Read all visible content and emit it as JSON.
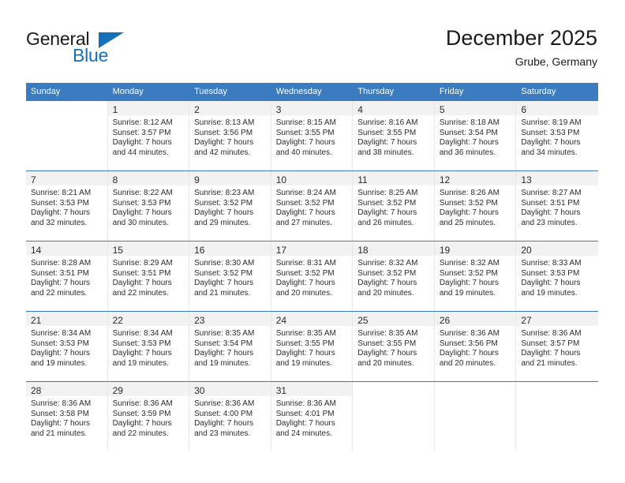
{
  "brand": {
    "name_part1": "General",
    "name_part2": "Blue",
    "flag_icon": "blue-triangle-flag-icon",
    "accent_color": "#1470b8"
  },
  "header": {
    "month_title": "December 2025",
    "location": "Grube, Germany"
  },
  "calendar": {
    "header_bg": "#3a7cbf",
    "daynum_bg": "#f2f2f2",
    "weekday_headers": [
      "Sunday",
      "Monday",
      "Tuesday",
      "Wednesday",
      "Thursday",
      "Friday",
      "Saturday"
    ],
    "weeks": [
      [
        {
          "day": "",
          "lines": []
        },
        {
          "day": "1",
          "lines": [
            "Sunrise: 8:12 AM",
            "Sunset: 3:57 PM",
            "Daylight: 7 hours",
            "and 44 minutes."
          ]
        },
        {
          "day": "2",
          "lines": [
            "Sunrise: 8:13 AM",
            "Sunset: 3:56 PM",
            "Daylight: 7 hours",
            "and 42 minutes."
          ]
        },
        {
          "day": "3",
          "lines": [
            "Sunrise: 8:15 AM",
            "Sunset: 3:55 PM",
            "Daylight: 7 hours",
            "and 40 minutes."
          ]
        },
        {
          "day": "4",
          "lines": [
            "Sunrise: 8:16 AM",
            "Sunset: 3:55 PM",
            "Daylight: 7 hours",
            "and 38 minutes."
          ]
        },
        {
          "day": "5",
          "lines": [
            "Sunrise: 8:18 AM",
            "Sunset: 3:54 PM",
            "Daylight: 7 hours",
            "and 36 minutes."
          ]
        },
        {
          "day": "6",
          "lines": [
            "Sunrise: 8:19 AM",
            "Sunset: 3:53 PM",
            "Daylight: 7 hours",
            "and 34 minutes."
          ]
        }
      ],
      [
        {
          "day": "7",
          "lines": [
            "Sunrise: 8:21 AM",
            "Sunset: 3:53 PM",
            "Daylight: 7 hours",
            "and 32 minutes."
          ]
        },
        {
          "day": "8",
          "lines": [
            "Sunrise: 8:22 AM",
            "Sunset: 3:53 PM",
            "Daylight: 7 hours",
            "and 30 minutes."
          ]
        },
        {
          "day": "9",
          "lines": [
            "Sunrise: 8:23 AM",
            "Sunset: 3:52 PM",
            "Daylight: 7 hours",
            "and 29 minutes."
          ]
        },
        {
          "day": "10",
          "lines": [
            "Sunrise: 8:24 AM",
            "Sunset: 3:52 PM",
            "Daylight: 7 hours",
            "and 27 minutes."
          ]
        },
        {
          "day": "11",
          "lines": [
            "Sunrise: 8:25 AM",
            "Sunset: 3:52 PM",
            "Daylight: 7 hours",
            "and 26 minutes."
          ]
        },
        {
          "day": "12",
          "lines": [
            "Sunrise: 8:26 AM",
            "Sunset: 3:52 PM",
            "Daylight: 7 hours",
            "and 25 minutes."
          ]
        },
        {
          "day": "13",
          "lines": [
            "Sunrise: 8:27 AM",
            "Sunset: 3:51 PM",
            "Daylight: 7 hours",
            "and 23 minutes."
          ]
        }
      ],
      [
        {
          "day": "14",
          "lines": [
            "Sunrise: 8:28 AM",
            "Sunset: 3:51 PM",
            "Daylight: 7 hours",
            "and 22 minutes."
          ]
        },
        {
          "day": "15",
          "lines": [
            "Sunrise: 8:29 AM",
            "Sunset: 3:51 PM",
            "Daylight: 7 hours",
            "and 22 minutes."
          ]
        },
        {
          "day": "16",
          "lines": [
            "Sunrise: 8:30 AM",
            "Sunset: 3:52 PM",
            "Daylight: 7 hours",
            "and 21 minutes."
          ]
        },
        {
          "day": "17",
          "lines": [
            "Sunrise: 8:31 AM",
            "Sunset: 3:52 PM",
            "Daylight: 7 hours",
            "and 20 minutes."
          ]
        },
        {
          "day": "18",
          "lines": [
            "Sunrise: 8:32 AM",
            "Sunset: 3:52 PM",
            "Daylight: 7 hours",
            "and 20 minutes."
          ]
        },
        {
          "day": "19",
          "lines": [
            "Sunrise: 8:32 AM",
            "Sunset: 3:52 PM",
            "Daylight: 7 hours",
            "and 19 minutes."
          ]
        },
        {
          "day": "20",
          "lines": [
            "Sunrise: 8:33 AM",
            "Sunset: 3:53 PM",
            "Daylight: 7 hours",
            "and 19 minutes."
          ]
        }
      ],
      [
        {
          "day": "21",
          "lines": [
            "Sunrise: 8:34 AM",
            "Sunset: 3:53 PM",
            "Daylight: 7 hours",
            "and 19 minutes."
          ]
        },
        {
          "day": "22",
          "lines": [
            "Sunrise: 8:34 AM",
            "Sunset: 3:53 PM",
            "Daylight: 7 hours",
            "and 19 minutes."
          ]
        },
        {
          "day": "23",
          "lines": [
            "Sunrise: 8:35 AM",
            "Sunset: 3:54 PM",
            "Daylight: 7 hours",
            "and 19 minutes."
          ]
        },
        {
          "day": "24",
          "lines": [
            "Sunrise: 8:35 AM",
            "Sunset: 3:55 PM",
            "Daylight: 7 hours",
            "and 19 minutes."
          ]
        },
        {
          "day": "25",
          "lines": [
            "Sunrise: 8:35 AM",
            "Sunset: 3:55 PM",
            "Daylight: 7 hours",
            "and 20 minutes."
          ]
        },
        {
          "day": "26",
          "lines": [
            "Sunrise: 8:36 AM",
            "Sunset: 3:56 PM",
            "Daylight: 7 hours",
            "and 20 minutes."
          ]
        },
        {
          "day": "27",
          "lines": [
            "Sunrise: 8:36 AM",
            "Sunset: 3:57 PM",
            "Daylight: 7 hours",
            "and 21 minutes."
          ]
        }
      ],
      [
        {
          "day": "28",
          "lines": [
            "Sunrise: 8:36 AM",
            "Sunset: 3:58 PM",
            "Daylight: 7 hours",
            "and 21 minutes."
          ]
        },
        {
          "day": "29",
          "lines": [
            "Sunrise: 8:36 AM",
            "Sunset: 3:59 PM",
            "Daylight: 7 hours",
            "and 22 minutes."
          ]
        },
        {
          "day": "30",
          "lines": [
            "Sunrise: 8:36 AM",
            "Sunset: 4:00 PM",
            "Daylight: 7 hours",
            "and 23 minutes."
          ]
        },
        {
          "day": "31",
          "lines": [
            "Sunrise: 8:36 AM",
            "Sunset: 4:01 PM",
            "Daylight: 7 hours",
            "and 24 minutes."
          ]
        },
        {
          "day": "",
          "lines": []
        },
        {
          "day": "",
          "lines": []
        },
        {
          "day": "",
          "lines": []
        }
      ]
    ]
  }
}
